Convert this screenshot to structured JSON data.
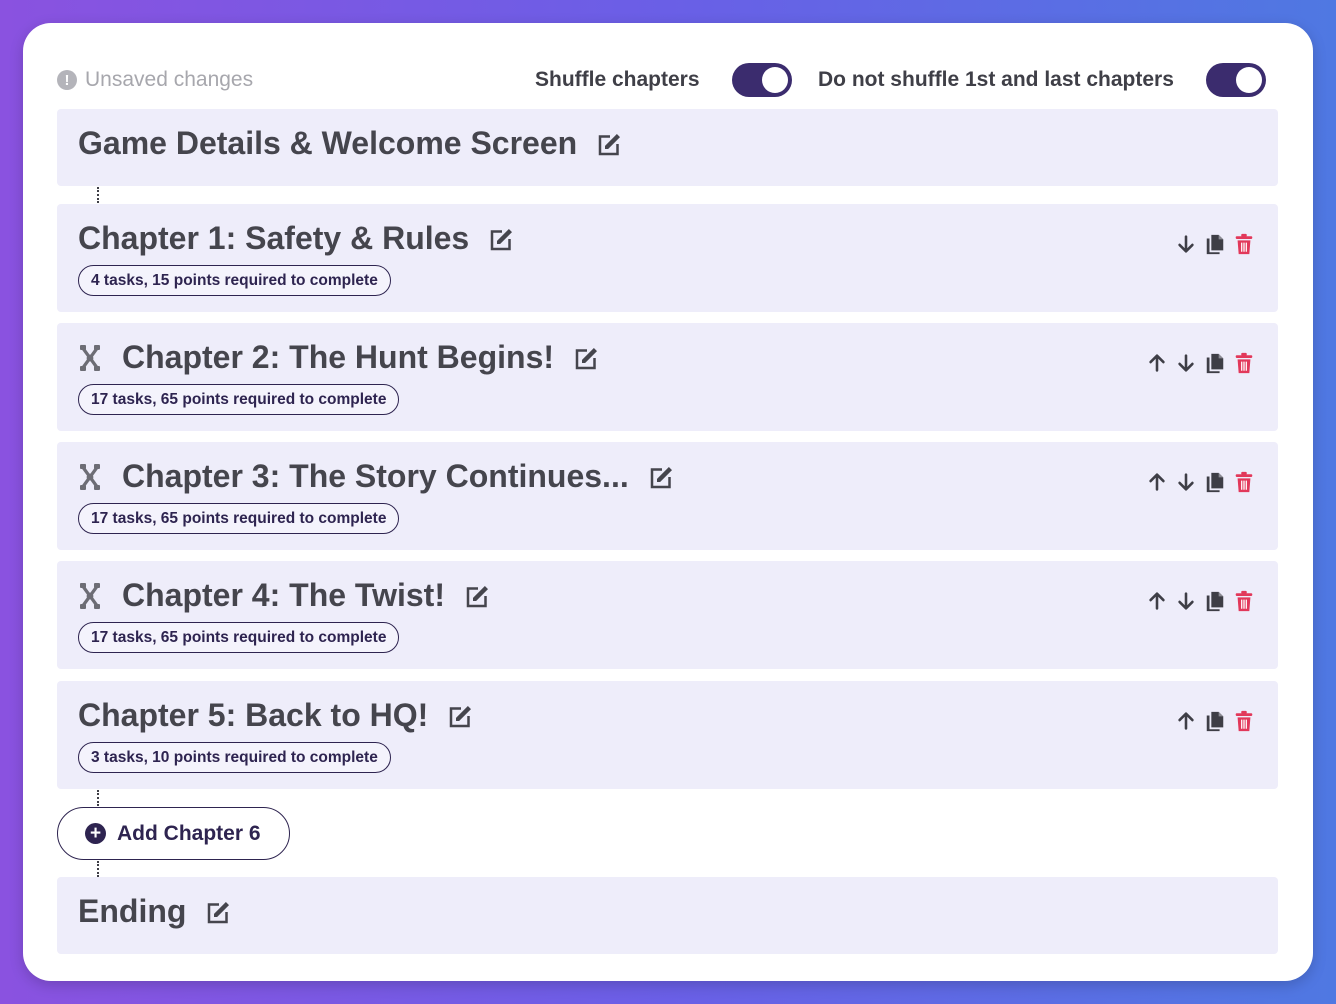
{
  "topbar": {
    "unsaved_label": "Unsaved changes",
    "shuffle_label": "Shuffle chapters",
    "shuffle_on": true,
    "keep_ends_label": "Do not shuffle 1st and last chapters",
    "keep_ends_on": true
  },
  "intro": {
    "title": "Game Details & Welcome Screen"
  },
  "chapters": [
    {
      "title": "Chapter 1: Safety & Rules",
      "summary": "4 tasks, 15 points required to complete",
      "draggable": false,
      "can_up": false,
      "can_down": true
    },
    {
      "title": "Chapter 2: The Hunt Begins!",
      "summary": "17 tasks, 65 points required to complete",
      "draggable": true,
      "can_up": true,
      "can_down": true
    },
    {
      "title": "Chapter 3: The Story Continues...",
      "summary": "17 tasks, 65 points required to complete",
      "draggable": true,
      "can_up": true,
      "can_down": true
    },
    {
      "title": "Chapter 4: The Twist!",
      "summary": "17 tasks, 65 points required to complete",
      "draggable": true,
      "can_up": true,
      "can_down": true
    },
    {
      "title": "Chapter 5: Back to HQ!",
      "summary": "3 tasks, 10 points required to complete",
      "draggable": false,
      "can_up": true,
      "can_down": false
    }
  ],
  "add_chapter": {
    "label": "Add Chapter 6"
  },
  "ending": {
    "title": "Ending"
  },
  "colors": {
    "accent": "#3b2c6e",
    "delete": "#e2385a",
    "panel": "#eeedfa"
  },
  "icons": {
    "edit": "edit-icon",
    "drag": "drag-handle-icon",
    "up": "arrow-up-icon",
    "down": "arrow-down-icon",
    "copy": "copy-icon",
    "delete": "trash-icon"
  }
}
